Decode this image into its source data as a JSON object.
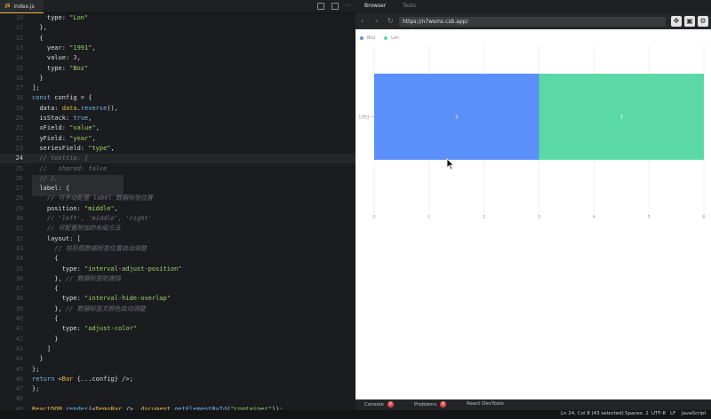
{
  "editor": {
    "tab_label": "index.js",
    "tab_badge": "JS",
    "active_line": 24,
    "lines": [
      {
        "n": 10,
        "html": "    <span class='pr'>type</span>: <span class='s'>\"Lon\"</span>"
      },
      {
        "n": 11,
        "html": "  },"
      },
      {
        "n": 12,
        "html": "  {"
      },
      {
        "n": 13,
        "html": "    <span class='pr'>year</span>: <span class='s'>\"1991\"</span>,"
      },
      {
        "n": 14,
        "html": "    <span class='pr'>value</span>: <span class='n'>3</span>,"
      },
      {
        "n": 15,
        "html": "    <span class='pr'>type</span>: <span class='s'>\"Boz\"</span>"
      },
      {
        "n": 16,
        "html": "  }"
      },
      {
        "n": 17,
        "html": "];"
      },
      {
        "n": 18,
        "html": "<span class='k'>const</span> config = {"
      },
      {
        "n": 19,
        "html": "  <span class='pr'>data</span>: <span class='fn'>data</span>.<span class='k'>reverse</span>(),"
      },
      {
        "n": 20,
        "html": "  <span class='pr'>isStack</span>: <span class='k'>true</span>,"
      },
      {
        "n": 21,
        "html": "  <span class='pr'>xField</span>: <span class='s'>\"value\"</span>,"
      },
      {
        "n": 22,
        "html": "  <span class='pr'>yField</span>: <span class='s'>\"year\"</span>,"
      },
      {
        "n": 23,
        "html": "  <span class='pr'>seriesField</span>: <span class='s'>\"type\"</span>,"
      },
      {
        "n": 24,
        "html": "  <span class='c'>// tooltip: {</span>"
      },
      {
        "n": 25,
        "html": "  <span class='c'>//   shared: false</span>"
      },
      {
        "n": 26,
        "html": "  <span class='c'>// },</span>"
      },
      {
        "n": 27,
        "html": "  <span class='pr'>label</span>: {"
      },
      {
        "n": 28,
        "html": "    <span class='c'>// 可手动配置 label 数据标签位置</span>"
      },
      {
        "n": 29,
        "html": "    <span class='pr'>position</span>: <span class='s'>\"middle\"</span>,"
      },
      {
        "n": 30,
        "html": "    <span class='c'>// 'left', 'middle', 'right'</span>"
      },
      {
        "n": 31,
        "html": "    <span class='c'>// 可配置附加的布局方法</span>"
      },
      {
        "n": 32,
        "html": "    <span class='pr'>layout</span>: ["
      },
      {
        "n": 33,
        "html": "      <span class='c'>// 柱形图数据标签位置自动调整</span>"
      },
      {
        "n": 34,
        "html": "      {"
      },
      {
        "n": 35,
        "html": "        <span class='pr'>type</span>: <span class='s'>\"interval-adjust-position\"</span>"
      },
      {
        "n": 36,
        "html": "      }, <span class='c'>// 数据标签防遮挡</span>"
      },
      {
        "n": 37,
        "html": "      {"
      },
      {
        "n": 38,
        "html": "        <span class='pr'>type</span>: <span class='s'>\"interval-hide-overlap\"</span>"
      },
      {
        "n": 39,
        "html": "      }, <span class='c'>// 数据标签文颜色自动调整</span>"
      },
      {
        "n": 40,
        "html": "      {"
      },
      {
        "n": 41,
        "html": "        <span class='pr'>type</span>: <span class='s'>\"adjust-color\"</span>"
      },
      {
        "n": 42,
        "html": "      }"
      },
      {
        "n": 43,
        "html": "    ]"
      },
      {
        "n": 44,
        "html": "  }"
      },
      {
        "n": 45,
        "html": "};"
      },
      {
        "n": 46,
        "html": "<span class='k'>return</span> &lt;<span class='b'>Bar</span> {...config} /&gt;;"
      },
      {
        "n": 47,
        "html": "};"
      },
      {
        "n": 48,
        "html": ""
      },
      {
        "n": 49,
        "html": "<span class='fn'>ReactDOM</span>.<span class='k'>render</span>(&lt;<span class='b'>DemoBar</span> /&gt;, <span class='fn'>document</span>.<span class='k'>getElementById</span>(<span class='s'>\"container\"</span>));"
      }
    ]
  },
  "preview_tabs": {
    "browser": "Browser",
    "tests": "Tests"
  },
  "browser": {
    "url": "https://n7wsms.csb.app/",
    "icons": [
      "back-icon",
      "forward-icon",
      "refresh-icon",
      "open-new-window-icon",
      "devtools-icon",
      "settings-icon"
    ]
  },
  "chart_data": {
    "type": "bar",
    "orientation": "horizontal",
    "stacked": true,
    "categories": [
      "1991"
    ],
    "series": [
      {
        "name": "Boz",
        "values": [
          3
        ],
        "color": "#5b8ff9"
      },
      {
        "name": "Lon",
        "values": [
          3
        ],
        "color": "#5ad8a6"
      }
    ],
    "xlim": [
      0,
      6
    ],
    "xticks": [
      "0",
      "1",
      "2",
      "3",
      "4",
      "5",
      "6"
    ],
    "grid": true,
    "legend_position": "top-left",
    "data_labels": [
      "3",
      "3"
    ]
  },
  "console_tabs": [
    {
      "label": "Console",
      "badge": "0"
    },
    {
      "label": "Problems",
      "badge": "0"
    },
    {
      "label": "React DevTools",
      "badge": ""
    }
  ],
  "status": {
    "position": "Ln 24, Col 8 (43 selected)",
    "spaces": "Spaces: 2",
    "encoding": "UTF-8",
    "eol": "LF",
    "language": "JavaScript"
  },
  "colors": {
    "accent": "#e8b544",
    "editor_bg": "#1b1c1f",
    "bar_boz": "#5b8ff9",
    "bar_lon": "#5ad8a6"
  }
}
